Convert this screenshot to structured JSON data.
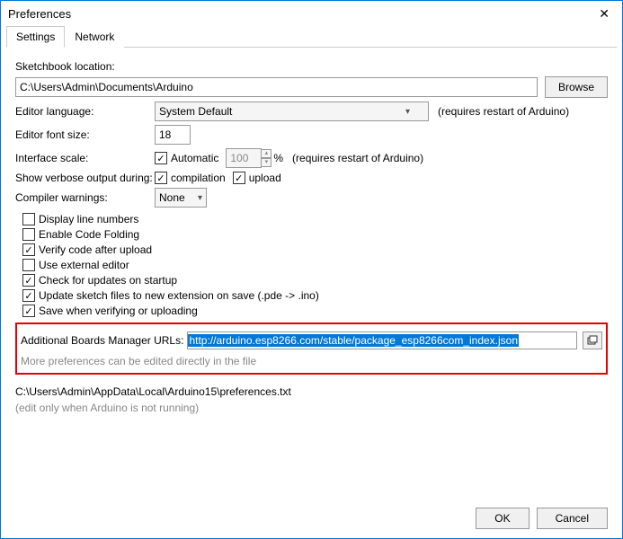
{
  "window": {
    "title": "Preferences"
  },
  "tabs": {
    "settings": "Settings",
    "network": "Network"
  },
  "sketchbook": {
    "label": "Sketchbook location:",
    "value": "C:\\Users\\Admin\\Documents\\Arduino",
    "browse": "Browse"
  },
  "language": {
    "label": "Editor language:",
    "value": "System Default",
    "note": "(requires restart of Arduino)"
  },
  "fontsize": {
    "label": "Editor font size:",
    "value": "18"
  },
  "scale": {
    "label": "Interface scale:",
    "auto": "Automatic",
    "value": "100",
    "pct": "%",
    "note": "(requires restart of Arduino)"
  },
  "verbose": {
    "label": "Show verbose output during:",
    "compilation": "compilation",
    "upload": "upload"
  },
  "warnings": {
    "label": "Compiler warnings:",
    "value": "None"
  },
  "options": {
    "display_line_numbers": "Display line numbers",
    "enable_code_folding": "Enable Code Folding",
    "verify_after_upload": "Verify code after upload",
    "use_external_editor": "Use external editor",
    "check_updates": "Check for updates on startup",
    "update_sketch_ext": "Update sketch files to new extension on save (.pde -> .ino)",
    "save_verify_upload": "Save when verifying or uploading"
  },
  "urls": {
    "label": "Additional Boards Manager URLs:",
    "value": "http://arduino.esp8266.com/stable/package_esp8266com_index.json"
  },
  "more_prefs": "More preferences can be edited directly in the file",
  "prefs_path": "C:\\Users\\Admin\\AppData\\Local\\Arduino15\\preferences.txt",
  "edit_note": "(edit only when Arduino is not running)",
  "buttons": {
    "ok": "OK",
    "cancel": "Cancel"
  }
}
